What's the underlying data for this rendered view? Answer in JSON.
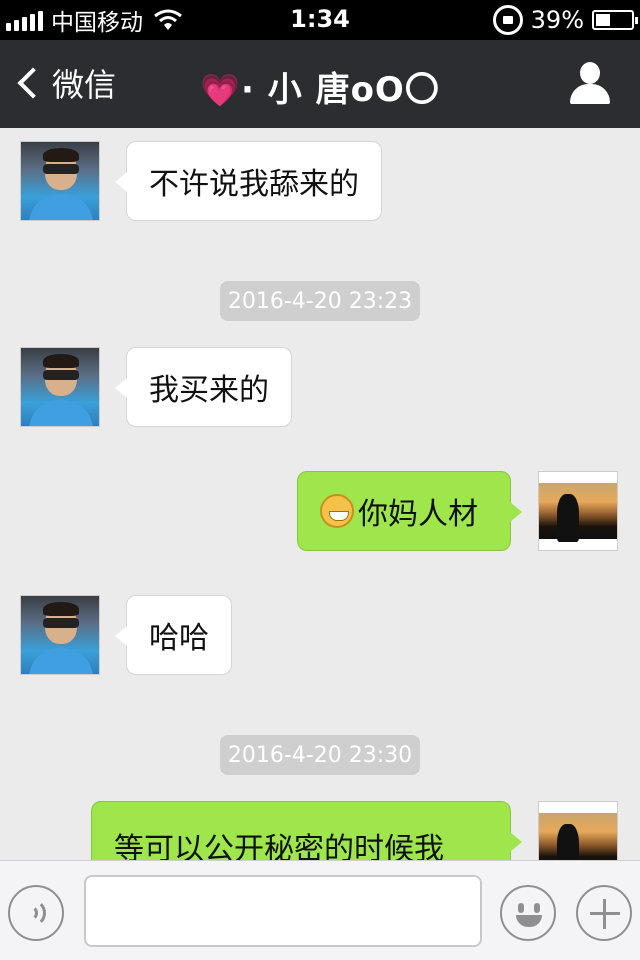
{
  "status_bar": {
    "carrier": "中国移动",
    "time": "1:34",
    "battery": "39%",
    "battery_level": 0.39,
    "icons": [
      "signal-icon",
      "wifi-icon",
      "rotation-lock-icon",
      "battery-icon"
    ]
  },
  "nav": {
    "back_label": "微信",
    "title_heart": "💗",
    "title_text": "· 小 唐oO〇",
    "right_icon": "user-profile-icon"
  },
  "messages": [
    {
      "side": "in",
      "text": "不许说我舔来的",
      "avatar": "avatar-man"
    },
    {
      "type": "timestamp",
      "text": "2016-4-20 23:23"
    },
    {
      "side": "in",
      "text": "我买来的",
      "avatar": "avatar-man"
    },
    {
      "side": "out",
      "emoji": "grin-emoji",
      "text": "你妈人材",
      "avatar": "avatar-sunset"
    },
    {
      "side": "in",
      "text": "哈哈",
      "avatar": "avatar-man"
    },
    {
      "type": "timestamp",
      "text": "2016-4-20 23:30"
    },
    {
      "side": "out",
      "text": "等可以公开秘密的时候我",
      "avatar": "avatar-sunset"
    }
  ],
  "input_bar": {
    "placeholder": "",
    "icons": [
      "voice-icon",
      "emoji-icon",
      "plus-icon"
    ]
  },
  "colors": {
    "nav_bg": "#2b2d31",
    "chat_bg": "#ebebeb",
    "bubble_out": "#9ee64b",
    "bubble_in": "#ffffff",
    "timestamp_bg": "#cfcfcf"
  }
}
